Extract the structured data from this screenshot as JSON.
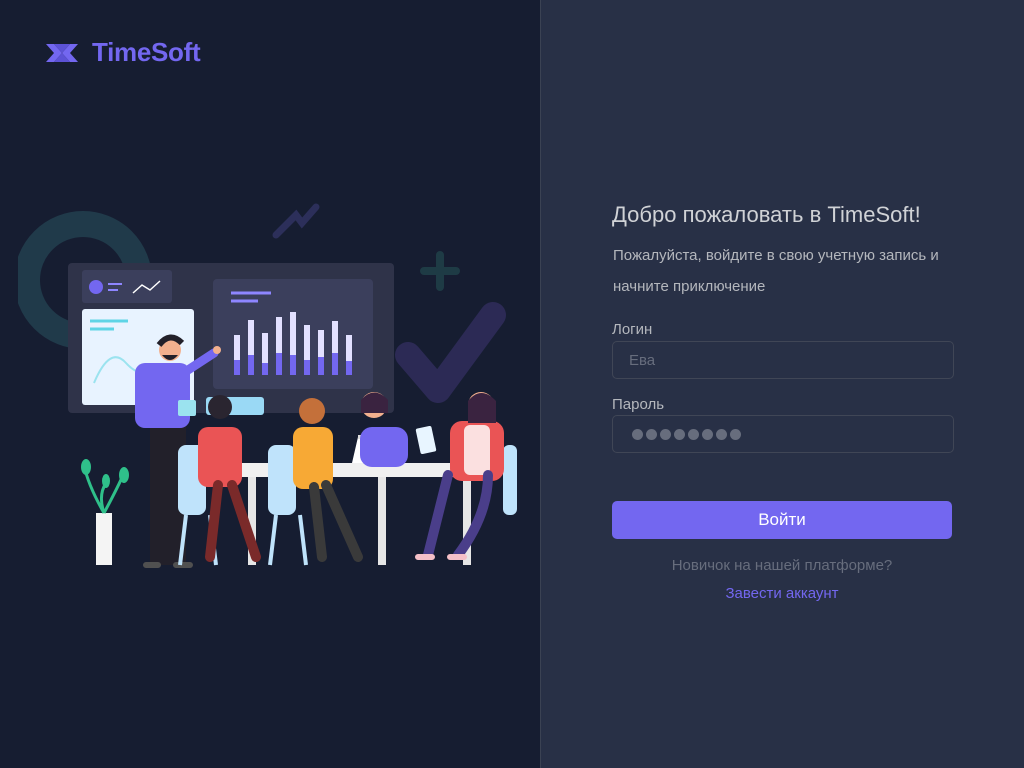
{
  "brand": {
    "name": "TimeSoft",
    "logo_icon": "timesoft-logo-icon",
    "accent_color": "#7367f0"
  },
  "illustration": {
    "icon": "team-meeting-illustration"
  },
  "login": {
    "title": "Добро пожаловать в TimeSoft!",
    "subtitle": "Пожалуйста, войдите в свою учетную запись и начните приключение",
    "username_label": "Логин",
    "username_placeholder": "Ева",
    "password_label": "Пароль",
    "password_mask_length": 8,
    "submit_label": "Войти",
    "new_user_text": "Новичок на нашей платформе?",
    "create_account_label": "Завести аккаунт"
  }
}
